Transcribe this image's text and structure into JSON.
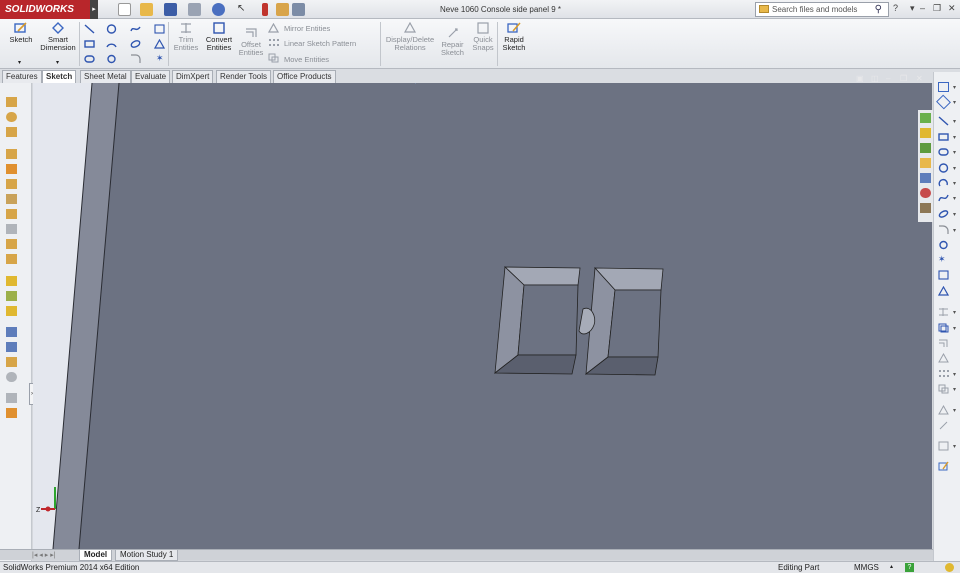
{
  "app": {
    "logo_text": "SOLIDWORKS",
    "document_title": "Neve 1060 Console side panel 9 *",
    "search_placeholder": "Search files and models"
  },
  "ribbon": {
    "sketch": "Sketch",
    "smart_dimension_1": "Smart",
    "smart_dimension_2": "Dimension",
    "trim_entities_1": "Trim",
    "trim_entities_2": "Entities",
    "convert_entities_1": "Convert",
    "convert_entities_2": "Entities",
    "offset_entities_1": "Offset",
    "offset_entities_2": "Entities",
    "mirror_entities": "Mirror Entities",
    "linear_sketch_pattern": "Linear Sketch Pattern",
    "move_entities": "Move Entities",
    "display_delete_relations_1": "Display/Delete",
    "display_delete_relations_2": "Relations",
    "repair_sketch_1": "Repair",
    "repair_sketch_2": "Sketch",
    "quick_snaps_1": "Quick",
    "quick_snaps_2": "Snaps",
    "rapid_sketch_1": "Rapid",
    "rapid_sketch_2": "Sketch"
  },
  "tabs": [
    {
      "label": "Features"
    },
    {
      "label": "Sketch"
    },
    {
      "label": "Sheet Metal"
    },
    {
      "label": "Evaluate"
    },
    {
      "label": "DimXpert"
    },
    {
      "label": "Render Tools"
    },
    {
      "label": "Office Products"
    }
  ],
  "bottom_tabs": [
    {
      "label": "Model"
    },
    {
      "label": "Motion Study 1"
    }
  ],
  "status": {
    "edition": "SolidWorks Premium 2014 x64 Edition",
    "mode": "Editing Part",
    "units": "MMGS"
  },
  "colors": {
    "viewport": "#6c7282",
    "accent_red": "#b8262b"
  }
}
